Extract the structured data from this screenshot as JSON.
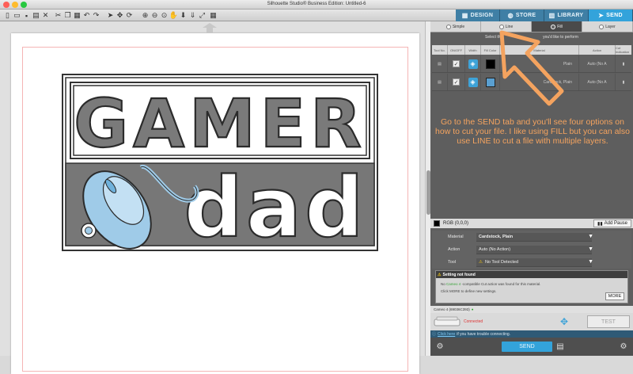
{
  "window": {
    "title": "Silhouette Studio® Business Edition: Untitled-6"
  },
  "toolbar": {
    "icons": [
      "new-document-icon",
      "open-folder-icon",
      "save-icon",
      "print-icon",
      "delete-icon",
      "undo-icon",
      "redo-icon",
      "cut-icon",
      "copy-icon",
      "paste-icon",
      "zoom-in-icon",
      "zoom-out-icon",
      "zoom-fit-icon",
      "pan-icon",
      "move-down-icon",
      "fit-page-icon",
      "grid-icon"
    ]
  },
  "tabs": [
    {
      "label": "DESIGN",
      "active": false,
      "icon": "grid-icon"
    },
    {
      "label": "STORE",
      "active": false,
      "icon": "globe-icon"
    },
    {
      "label": "LIBRARY",
      "active": false,
      "icon": "library-icon"
    },
    {
      "label": "SEND",
      "active": true,
      "icon": "send-icon"
    }
  ],
  "design": {
    "top_word": "GAMER",
    "bottom_word": "dad"
  },
  "send_panel": {
    "modes": [
      {
        "label": "Simple",
        "active": false
      },
      {
        "label": "Line",
        "active": false
      },
      {
        "label": "Fill",
        "active": true
      },
      {
        "label": "Layer",
        "active": false
      }
    ],
    "mode_hint_left": "Select the",
    "mode_hint_right": "you'd like to perform",
    "columns": [
      "Tool No.",
      "ON/OFF",
      "Width",
      "Fill Color",
      "Material",
      "Action",
      "Cut Indication"
    ],
    "rows": [
      {
        "material": "Plain",
        "action": "Auto (No A",
        "color": "#000000"
      },
      {
        "material": "Cardstock, Plain",
        "action": "Auto (No A",
        "color": "#5a9fd0"
      }
    ],
    "color_row": {
      "label": "RGB (0,0,0)",
      "add_pause": "Add Pause"
    },
    "settings": {
      "material_label": "Material",
      "material_value": "Cardstock, Plain",
      "action_label": "Action",
      "action_value": "Auto (No Action)",
      "tool_label": "Tool",
      "tool_value": "No Tool Detected"
    },
    "warning": {
      "title": "Setting not found",
      "line1_pre": "No ",
      "line1_device": "Cameo 4",
      "line1_post": " -compatible Cut action was found for this material.",
      "line2": "Click MORE to define new settings.",
      "more_label": "MORE"
    },
    "device": {
      "label": "Cameo 4 (69036C393)",
      "status": "Connected"
    },
    "test_label": "TEST",
    "help": {
      "link": "Click here",
      "text": "if you have trouble connecting."
    },
    "send_label": "SEND"
  },
  "annotation": {
    "text": "Go to the SEND tab and you'll see four options on how to cut your file. I like using FILL but you can also use LINE to cut a file with multiple layers.",
    "color": "#f4a35f"
  }
}
